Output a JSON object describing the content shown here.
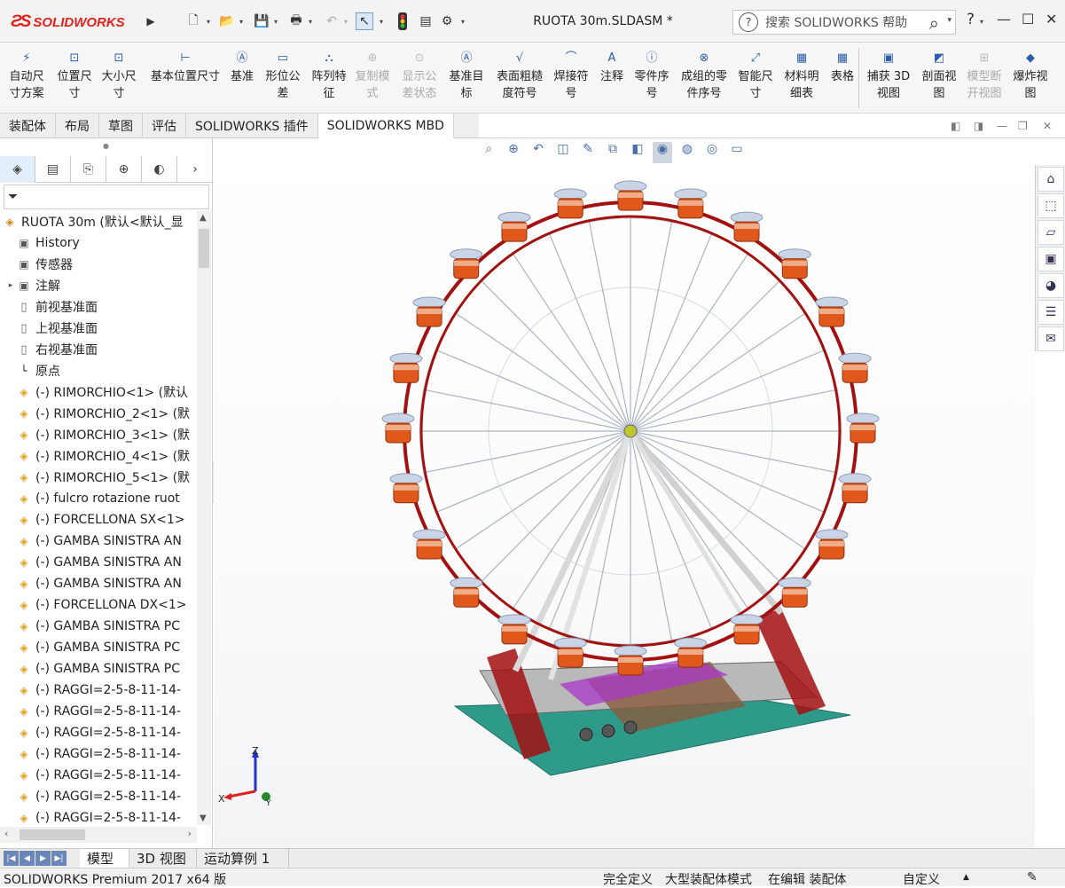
{
  "app": {
    "logo": "SOLIDWORKS",
    "doc_title": "RUOTA 30m.SLDASM *"
  },
  "search": {
    "placeholder": "搜索 SOLIDWORKS 帮助"
  },
  "window": {
    "help_label": "?",
    "minimize": "—",
    "maximize": "☐",
    "close": "✕"
  },
  "ribbon": {
    "items": [
      {
        "line1": "自动尺",
        "line2": "寸方案",
        "disabled": false
      },
      {
        "line1": "位置尺",
        "line2": "寸",
        "disabled": false
      },
      {
        "line1": "大小尺",
        "line2": "寸",
        "disabled": false
      },
      {
        "line1": "基本位置尺寸",
        "line2": "",
        "disabled": false
      },
      {
        "line1": "基准",
        "line2": "",
        "disabled": false
      },
      {
        "line1": "形位公",
        "line2": "差",
        "disabled": false
      },
      {
        "line1": "阵列特",
        "line2": "征",
        "disabled": false
      },
      {
        "line1": "复制模",
        "line2": "式",
        "disabled": true
      },
      {
        "line1": "显示公",
        "line2": "差状态",
        "disabled": true
      },
      {
        "line1": "基准目",
        "line2": "标",
        "disabled": false
      },
      {
        "line1": "表面粗糙",
        "line2": "度符号",
        "disabled": false
      },
      {
        "line1": "焊接符",
        "line2": "号",
        "disabled": false
      },
      {
        "line1": "注释",
        "line2": "",
        "disabled": false
      },
      {
        "line1": "零件序",
        "line2": "号",
        "disabled": false
      },
      {
        "line1": "成组的零",
        "line2": "件序号",
        "disabled": false
      },
      {
        "line1": "智能尺",
        "line2": "寸",
        "disabled": false
      },
      {
        "line1": "材料明",
        "line2": "细表",
        "disabled": false
      },
      {
        "line1": "表格",
        "line2": "",
        "disabled": false
      },
      {
        "line1": "捕获 3D",
        "line2": "视图",
        "disabled": false
      },
      {
        "line1": "剖面视",
        "line2": "图",
        "disabled": false
      },
      {
        "line1": "模型断",
        "line2": "开视图",
        "disabled": true
      },
      {
        "line1": "爆炸视",
        "line2": "图",
        "disabled": false
      }
    ]
  },
  "command_tabs": [
    "装配体",
    "布局",
    "草图",
    "评估",
    "SOLIDWORKS 插件",
    "SOLIDWORKS MBD"
  ],
  "active_command_tab": "SOLIDWORKS MBD",
  "tree": {
    "nodes": [
      {
        "label": "RUOTA 30m  (默认<默认_显",
        "icon": "asm",
        "exp": ""
      },
      {
        "label": "History",
        "icon": "folder",
        "exp": ""
      },
      {
        "label": "传感器",
        "icon": "folder",
        "exp": ""
      },
      {
        "label": "注解",
        "icon": "folder",
        "exp": "▸"
      },
      {
        "label": "前视基准面",
        "icon": "plane",
        "exp": ""
      },
      {
        "label": "上视基准面",
        "icon": "plane",
        "exp": ""
      },
      {
        "label": "右视基准面",
        "icon": "plane",
        "exp": ""
      },
      {
        "label": "原点",
        "icon": "origin",
        "exp": ""
      },
      {
        "label": "(-) RIMORCHIO<1> (默认",
        "icon": "part",
        "exp": ""
      },
      {
        "label": "(-) RIMORCHIO_2<1> (默",
        "icon": "part",
        "exp": ""
      },
      {
        "label": "(-) RIMORCHIO_3<1> (默",
        "icon": "part",
        "exp": ""
      },
      {
        "label": "(-) RIMORCHIO_4<1> (默",
        "icon": "part",
        "exp": ""
      },
      {
        "label": "(-) RIMORCHIO_5<1> (默",
        "icon": "part",
        "exp": ""
      },
      {
        "label": "(-) fulcro rotazione ruot",
        "icon": "part",
        "exp": ""
      },
      {
        "label": "(-) FORCELLONA SX<1>",
        "icon": "part",
        "exp": ""
      },
      {
        "label": "(-) GAMBA SINISTRA AN",
        "icon": "part",
        "exp": ""
      },
      {
        "label": "(-) GAMBA SINISTRA AN",
        "icon": "part",
        "exp": ""
      },
      {
        "label": "(-) GAMBA SINISTRA AN",
        "icon": "part",
        "exp": ""
      },
      {
        "label": "(-) FORCELLONA DX<1>",
        "icon": "part",
        "exp": ""
      },
      {
        "label": "(-) GAMBA SINISTRA PC",
        "icon": "part",
        "exp": ""
      },
      {
        "label": "(-) GAMBA SINISTRA PC",
        "icon": "part",
        "exp": ""
      },
      {
        "label": "(-) GAMBA SINISTRA PC",
        "icon": "part",
        "exp": ""
      },
      {
        "label": "(-) RAGGI=2-5-8-11-14-",
        "icon": "part",
        "exp": ""
      },
      {
        "label": "(-) RAGGI=2-5-8-11-14-",
        "icon": "part",
        "exp": ""
      },
      {
        "label": "(-) RAGGI=2-5-8-11-14-",
        "icon": "part",
        "exp": ""
      },
      {
        "label": "(-) RAGGI=2-5-8-11-14-",
        "icon": "part",
        "exp": ""
      },
      {
        "label": "(-) RAGGI=2-5-8-11-14-",
        "icon": "part",
        "exp": ""
      },
      {
        "label": "(-) RAGGI=2-5-8-11-14-",
        "icon": "part",
        "exp": ""
      },
      {
        "label": "(-) RAGGI=2-5-8-11-14-",
        "icon": "part",
        "exp": ""
      }
    ]
  },
  "bottom_tabs": [
    "模型",
    "3D 视图",
    "运动算例 1"
  ],
  "active_bottom_tab": "模型",
  "status": {
    "product": "SOLIDWORKS Premium 2017 x64 版",
    "definition": "完全定义",
    "mode": "大型装配体模式",
    "editing": "在编辑 装配体",
    "units": "自定义"
  },
  "triad": {
    "x": "X",
    "y": "Y",
    "z": "Z"
  },
  "colors": {
    "rim": "#a31010",
    "base": "#2e9b8a",
    "cabin": "#e0581c",
    "accent": "#a838c8"
  }
}
